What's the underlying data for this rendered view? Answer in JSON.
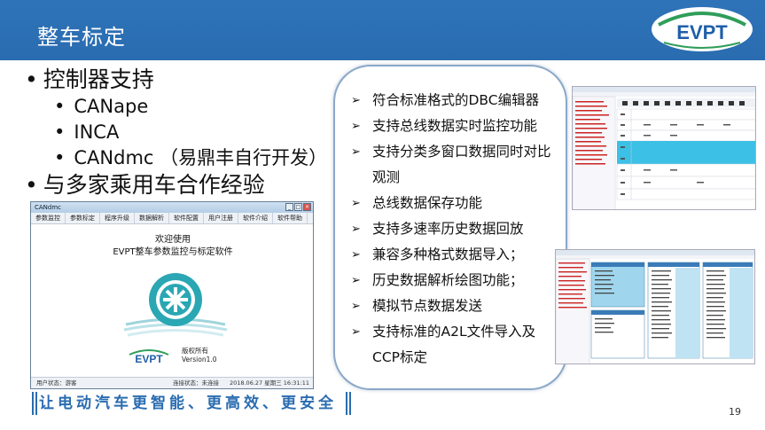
{
  "header": {
    "title": "整车标定",
    "logo_text": "EVPT"
  },
  "bullets": {
    "item1": "控制器支持",
    "sub": [
      "CANape",
      "INCA",
      "CANdmc （易鼎丰自行开发）"
    ],
    "item2": "与多家乘用车合作经验"
  },
  "window": {
    "title": "CANdmc",
    "menu": [
      "参数监控",
      "参数标定",
      "程序升级",
      "数据解析",
      "软件配置",
      "用户注册",
      "软件介绍",
      "软件帮助"
    ],
    "welcome_line1": "欢迎使用",
    "welcome_line2": "EVPT整车参数监控与标定软件",
    "logo_text": "EVPT",
    "copyright_line1": "版权所有",
    "copyright_line2": "Version1.0",
    "status_user": "用户状态：游客",
    "status_conn": "连接状态：未连接",
    "status_time": "2018.06.27    星期三    16:31:11"
  },
  "slogan": "让电动汽车更智能、更高效、更安全",
  "features": [
    "符合标准格式的DBC编辑器",
    "支持总线数据实时监控功能",
    "支持分类多窗口数据同时对比观测",
    "总线数据保存功能",
    "支持多速率历史数据回放",
    "兼容多种格式数据导入；",
    "历史数据解析绘图功能；",
    "模拟节点数据发送",
    "支持标准的A2L文件导入及CCP标定"
  ],
  "page_number": "19",
  "colors": {
    "header_blue": "#2a6cb0",
    "logo_green": "#2f9e5a",
    "logo_blue": "#1f5fa8",
    "cyan_rows": "#3cc0e6"
  }
}
